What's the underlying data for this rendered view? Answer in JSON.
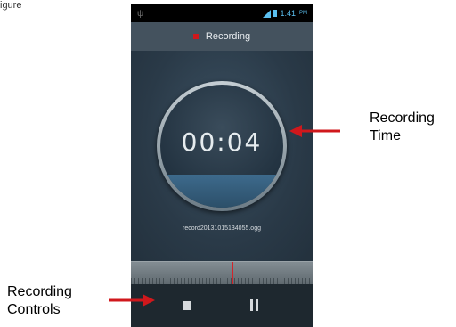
{
  "page_caption": "igure",
  "status_bar": {
    "time": "1:41",
    "ampm": "PM",
    "accent_color": "#5bc0f0",
    "icons": [
      "usb-icon",
      "signal-icon",
      "battery-icon"
    ]
  },
  "header": {
    "title": "Recording",
    "indicator_color": "#d0181c"
  },
  "recorder": {
    "elapsed_time": "00:04",
    "filename": "record20131015134055.ogg"
  },
  "timeline": {
    "playhead_color": "#d1242a"
  },
  "controls": {
    "buttons": [
      "stop-icon",
      "pause-icon"
    ]
  },
  "annotations": {
    "recording_time": {
      "line1": "Recording",
      "line2": "Time"
    },
    "recording_controls": {
      "line1": "Recording",
      "line2": "Controls"
    },
    "arrow_color": "#d0181c"
  }
}
